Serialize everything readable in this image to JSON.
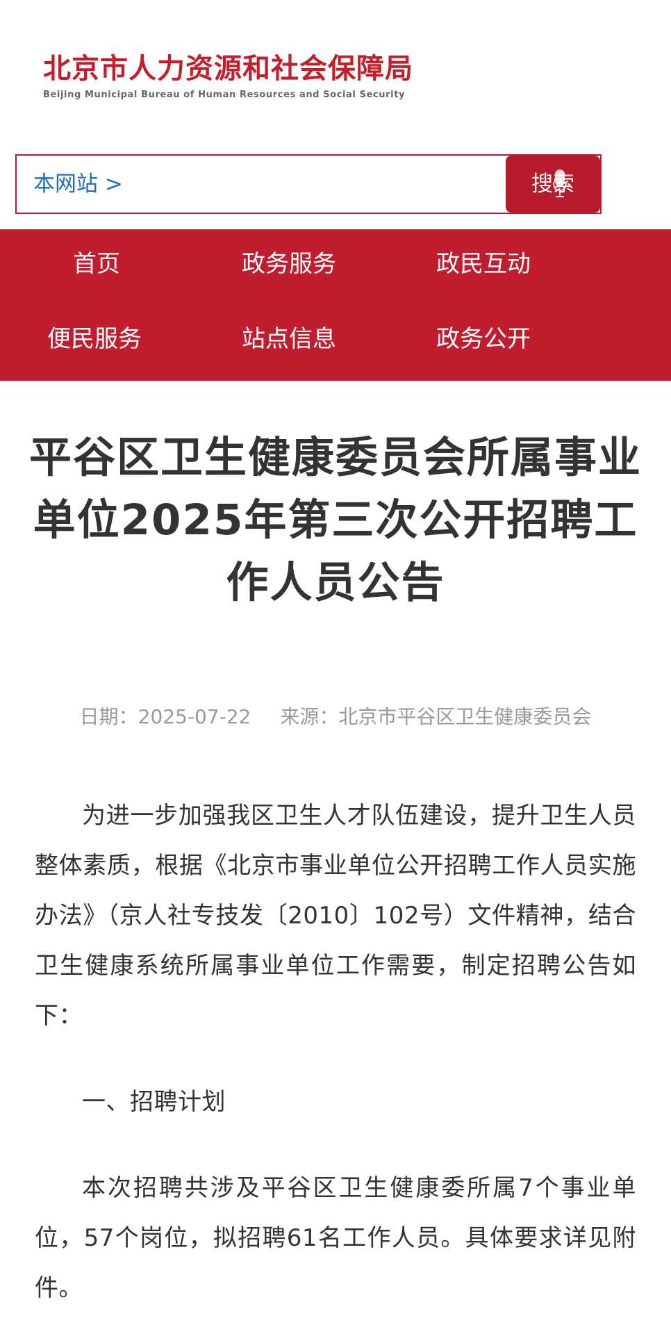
{
  "header": {
    "logo_cn": "北京市人力资源和社会保障局",
    "logo_en": "Beijing Municipal Bureau of Human Resources and Social Security"
  },
  "search": {
    "scope": "本网站 >",
    "placeholder": "",
    "button_label": "搜索"
  },
  "nav": {
    "items": [
      {
        "label": "首页"
      },
      {
        "label": "政务服务"
      },
      {
        "label": "政民互动"
      },
      {
        "label": "便民服务"
      },
      {
        "label": "站点信息"
      },
      {
        "label": "政务公开"
      }
    ]
  },
  "article": {
    "title": "平谷区卫生健康委员会所属事业单位2025年第三次公开招聘工作人员公告",
    "date": "日期：2025-07-22",
    "source": "来源：北京市平谷区卫生健康委员会",
    "paragraphs": [
      "为进一步加强我区卫生人才队伍建设，提升卫生人员整体素质，根据《北京市事业单位公开招聘工作人员实施办法》（京人社专技发〔2010〕102号）文件精神，结合卫生健康系统所属事业单位工作需要，制定招聘公告如下：",
      "一、招聘计划",
      "本次招聘共涉及平谷区卫生健康委所属7个事业单位，57个岗位，拟招聘61名工作人员。具体要求详见附件。"
    ]
  },
  "colors": {
    "brand_red": "#c01d2e",
    "link_blue": "#1a6fc9",
    "meta_gray": "#999999"
  }
}
